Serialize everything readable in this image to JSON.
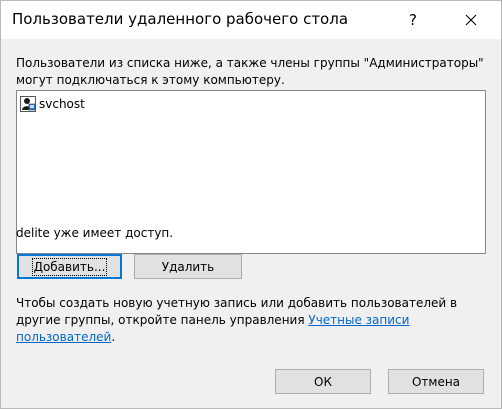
{
  "window": {
    "title": "Пользователи удаленного рабочего стола",
    "help_glyph": "?",
    "close_icon": "close-icon"
  },
  "intro_text": "Пользователи из списка ниже, а также члены группы \"Администраторы\" могут подключаться к этому компьютеру.",
  "users_list": {
    "items": [
      {
        "name": "svchost",
        "icon": "user-icon"
      }
    ]
  },
  "status_text": "delite уже имеет доступ.",
  "buttons": {
    "add_label": "Добавить...",
    "remove_label": "Удалить",
    "ok_label": "ОК",
    "cancel_label": "Отмена"
  },
  "info": {
    "text": "Чтобы создать новую учетную запись или добавить пользователей в другие группы, откройте панель управления ",
    "link_part1": "Учетные записи",
    "link_part2": "пользователей",
    "suffix": "."
  },
  "colors": {
    "link": "#0066cc",
    "dialog_bg": "#f0f0f0",
    "focus_border": "#0078d7"
  }
}
